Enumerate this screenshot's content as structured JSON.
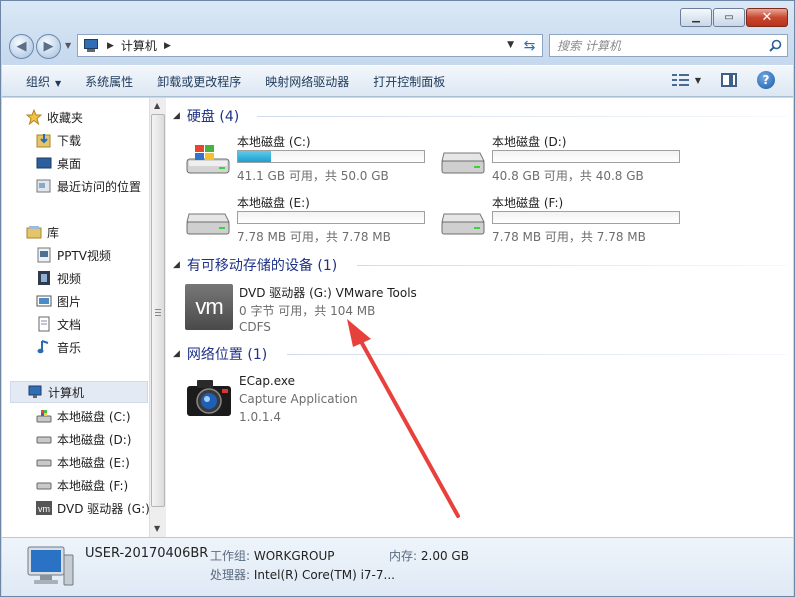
{
  "nav": {
    "address_location": "计算机",
    "search_placeholder": "搜索 计算机"
  },
  "toolbar": {
    "organize": "组织",
    "system_properties": "系统属性",
    "uninstall": "卸载或更改程序",
    "map_drive": "映射网络驱动器",
    "control_panel": "打开控制面板"
  },
  "sidebar": {
    "favorites": "收藏夹",
    "downloads": "下载",
    "desktop": "桌面",
    "recent": "最近访问的位置",
    "libraries": "库",
    "pptv": "PPTV视频",
    "videos": "视频",
    "pictures": "图片",
    "documents": "文档",
    "music": "音乐",
    "computer": "计算机",
    "drive_c": "本地磁盘 (C:)",
    "drive_d": "本地磁盘 (D:)",
    "drive_e": "本地磁盘 (E:)",
    "drive_f": "本地磁盘 (F:)",
    "dvd": "DVD 驱动器 (G:)"
  },
  "groups": {
    "hard_disks": "硬盘 (4)",
    "removable": "有可移动存储的设备 (1)",
    "network": "网络位置 (1)"
  },
  "drives": [
    {
      "name": "本地磁盘 (C:)",
      "info": "41.1 GB 可用，共 50.0 GB",
      "used_fraction": 0.18
    },
    {
      "name": "本地磁盘 (D:)",
      "info": "40.8 GB 可用，共 40.8 GB",
      "used_fraction": 0.0
    },
    {
      "name": "本地磁盘 (E:)",
      "info": "7.78 MB 可用，共 7.78 MB",
      "used_fraction": 0.0
    },
    {
      "name": "本地磁盘 (F:)",
      "info": "7.78 MB 可用，共 7.78 MB",
      "used_fraction": 0.0
    }
  ],
  "dvd": {
    "name": "DVD 驱动器 (G:) VMware Tools",
    "info": "0 字节 可用，共 104 MB",
    "fs": "CDFS",
    "logo": "vm"
  },
  "network_item": {
    "name": "ECap.exe",
    "type": "Capture Application",
    "version": "1.0.1.4"
  },
  "details": {
    "computer_name": "USER-20170406BR",
    "workgroup_label": "工作组:",
    "workgroup_value": "WORKGROUP",
    "memory_label": "内存:",
    "memory_value": "2.00 GB",
    "processor_label": "处理器:",
    "processor_value": "Intel(R) Core(TM) i7-7..."
  },
  "colors": {
    "accent": "#1e3287",
    "annotation_arrow": "#e8413c",
    "drive_fill": "#1e9fd0"
  }
}
